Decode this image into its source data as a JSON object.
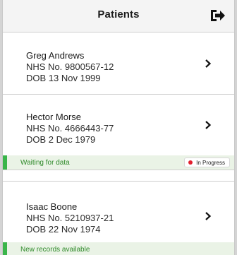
{
  "header": {
    "title": "Patients",
    "logout_icon": "logout-icon"
  },
  "patients": [
    {
      "name": "Greg Andrews",
      "nhs": "NHS No. 9800567-12",
      "dob": "DOB 13 Nov 1999",
      "status": "",
      "badge": ""
    },
    {
      "name": "Hector Morse",
      "nhs": "NHS No. 4666443-77",
      "dob": "DOB 2 Dec 1979",
      "status": "Waiting for data",
      "badge": "In Progress"
    },
    {
      "name": "Isaac Boone",
      "nhs": "NHS No. 5210937-21",
      "dob": "DOB 22 Nov 1974",
      "status": "New records available",
      "badge": ""
    }
  ],
  "colors": {
    "status_green": "#3ab54a",
    "status_bg": "#eaf3e6",
    "badge_dot_red": "#e2202e"
  }
}
